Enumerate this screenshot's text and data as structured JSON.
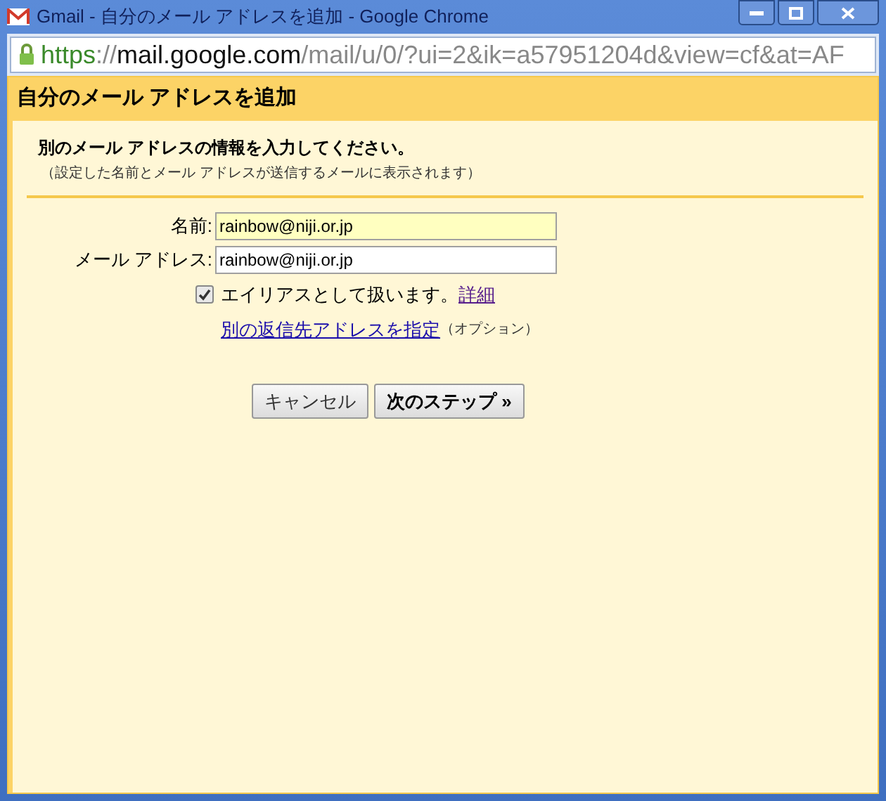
{
  "window": {
    "title": "Gmail - 自分のメール アドレスを追加 - Google Chrome"
  },
  "address_bar": {
    "scheme": "https",
    "separator": "://",
    "host": "mail.google.com",
    "path": "/mail/u/0/?ui=2&ik=a57951204d&view=cf&at=AF"
  },
  "dialog": {
    "title": "自分のメール アドレスを追加",
    "heading": "別のメール アドレスの情報を入力してください。",
    "note": "（設定した名前とメール アドレスが送信するメールに表示されます）"
  },
  "fields": [
    {
      "label": "名前:",
      "value": "rainbow@niji.or.jp",
      "highlighted": true
    },
    {
      "label": "メール アドレス:",
      "value": "rainbow@niji.or.jp",
      "highlighted": false
    }
  ],
  "alias": {
    "label": "エイリアスとして扱います。",
    "checked": true,
    "link": "詳細"
  },
  "reply_to": {
    "link": "別の返信先アドレスを指定",
    "note": "（オプション）"
  },
  "buttons": [
    {
      "label": "キャンセル",
      "primary": false
    },
    {
      "label": "次のステップ »",
      "primary": true
    }
  ]
}
